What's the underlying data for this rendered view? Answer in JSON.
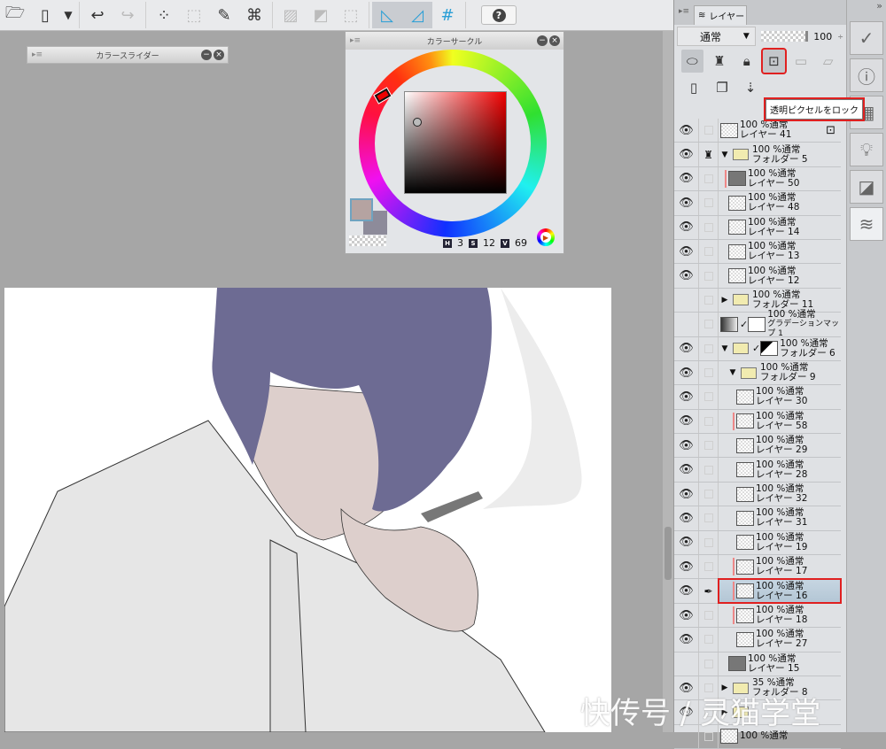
{
  "toolbar": {
    "icons": [
      "open-icon",
      "save-icon",
      "dropdown-icon",
      "undo-icon",
      "redo-icon",
      "selection-dots-icon",
      "deselect-icon",
      "fill-selection-icon",
      "transform-icon",
      "clear-icon",
      "invert-icon",
      "border-icon",
      "snap-ruler-icon",
      "snap-special-ruler-icon",
      "snap-grid-icon",
      "help-icon"
    ],
    "help_label": "?"
  },
  "color_slider": {
    "title": "カラースライダー"
  },
  "color_circle": {
    "title": "カラーサークル",
    "h_label": "H",
    "h": "3",
    "s_label": "S",
    "s": "12",
    "v_label": "V",
    "v": "69",
    "main_color": "#b5a3a1",
    "sub_color": "#8d8b9a"
  },
  "layer_panel": {
    "tab": "レイヤー",
    "blend_mode": "通常",
    "opacity": "100",
    "tooltip": "透明ピクセルをロック"
  },
  "layers": [
    {
      "mode": "100 %通常",
      "name": "レイヤー 41",
      "type": "layer",
      "visible": true,
      "indent": 0,
      "lock": true
    },
    {
      "mode": "100 %通常",
      "name": "フォルダー 5",
      "type": "folder",
      "visible": true,
      "indent": 0,
      "expanded": true,
      "ref": true
    },
    {
      "mode": "100 %通常",
      "name": "レイヤー 50",
      "type": "layer",
      "visible": true,
      "indent": 1,
      "clip": true,
      "dark": true
    },
    {
      "mode": "100 %通常",
      "name": "レイヤー 48",
      "type": "layer",
      "visible": true,
      "indent": 1
    },
    {
      "mode": "100 %通常",
      "name": "レイヤー 14",
      "type": "layer",
      "visible": true,
      "indent": 1
    },
    {
      "mode": "100 %通常",
      "name": "レイヤー 13",
      "type": "layer",
      "visible": true,
      "indent": 1
    },
    {
      "mode": "100 %通常",
      "name": "レイヤー 12",
      "type": "layer",
      "visible": true,
      "indent": 1
    },
    {
      "mode": "100 %通常",
      "name": "フォルダー 11",
      "type": "folder",
      "visible": false,
      "indent": 0,
      "expanded": false
    },
    {
      "mode": "100 %通常",
      "name": "グラデーションマップ 1",
      "type": "gradient",
      "visible": false,
      "indent": 0
    },
    {
      "mode": "100 %通常",
      "name": "フォルダー 6",
      "type": "folder",
      "visible": true,
      "indent": 0,
      "expanded": true,
      "mask": true
    },
    {
      "mode": "100 %通常",
      "name": "フォルダー 9",
      "type": "folder",
      "visible": true,
      "indent": 1,
      "expanded": true
    },
    {
      "mode": "100 %通常",
      "name": "レイヤー 30",
      "type": "layer",
      "visible": true,
      "indent": 2
    },
    {
      "mode": "100 %通常",
      "name": "レイヤー 58",
      "type": "layer",
      "visible": true,
      "indent": 2,
      "clip": true
    },
    {
      "mode": "100 %通常",
      "name": "レイヤー 29",
      "type": "layer",
      "visible": true,
      "indent": 2
    },
    {
      "mode": "100 %通常",
      "name": "レイヤー 28",
      "type": "layer",
      "visible": true,
      "indent": 2
    },
    {
      "mode": "100 %通常",
      "name": "レイヤー 32",
      "type": "layer",
      "visible": true,
      "indent": 2
    },
    {
      "mode": "100 %通常",
      "name": "レイヤー 31",
      "type": "layer",
      "visible": true,
      "indent": 2
    },
    {
      "mode": "100 %通常",
      "name": "レイヤー 19",
      "type": "layer",
      "visible": true,
      "indent": 2
    },
    {
      "mode": "100 %通常",
      "name": "レイヤー 17",
      "type": "layer",
      "visible": true,
      "indent": 2,
      "clip": true
    },
    {
      "mode": "100 %通常",
      "name": "レイヤー 16",
      "type": "layer",
      "visible": true,
      "indent": 2,
      "clip": true,
      "selected": true
    },
    {
      "mode": "100 %通常",
      "name": "レイヤー 18",
      "type": "layer",
      "visible": true,
      "indent": 2,
      "clip": true
    },
    {
      "mode": "100 %通常",
      "name": "レイヤー 27",
      "type": "layer",
      "visible": true,
      "indent": 2
    },
    {
      "mode": "100 %通常",
      "name": "レイヤー 15",
      "type": "layer",
      "visible": false,
      "indent": 1,
      "dark": true
    },
    {
      "mode": "35 %通常",
      "name": "フォルダー 8",
      "type": "folder",
      "visible": true,
      "indent": 0,
      "expanded": false
    },
    {
      "mode": "",
      "name": "",
      "type": "folder",
      "visible": true,
      "indent": 0,
      "expanded": false
    },
    {
      "mode": "100 %通常",
      "name": "",
      "type": "layer",
      "visible": false,
      "indent": 0
    }
  ],
  "watermark": "快传号 / 灵猫学堂",
  "colors": {
    "highlight": "#e02020",
    "hair": "#6d6b93",
    "skin": "#ddcfcc",
    "shirt": "#e4e4e4"
  }
}
